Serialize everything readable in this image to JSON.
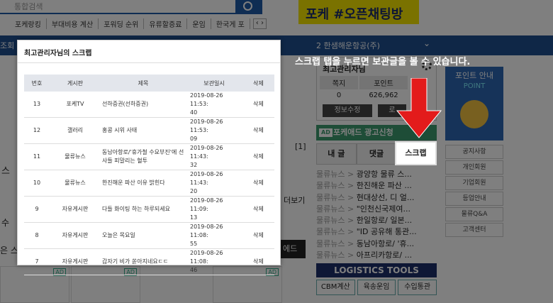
{
  "background": {
    "search_placeholder": "통합검색",
    "quick_links": [
      "포케랑킹",
      "부대비용 계산",
      "포워딩 순위",
      "유류할증료",
      "운임",
      "한국게 포"
    ],
    "ad_banner_text": "포케 #오픈채팅방",
    "nav_left": "조회",
    "nav_item": "2  한샘해운항공(주)",
    "login": {
      "user": "최고관리자님",
      "stats": [
        {
          "label": "쪽지",
          "value": "0"
        },
        {
          "label": "포인트",
          "value": "626,962"
        }
      ],
      "buttons": [
        "정보수정",
        "로"
      ]
    },
    "ad_strip": {
      "tag": "AD",
      "text": "포케애드 광고신청"
    },
    "tabs": [
      {
        "label": "내 글"
      },
      {
        "label": "댓글"
      },
      {
        "label": "스크랩"
      }
    ],
    "posts": [
      {
        "cat": "물류뉴스 >",
        "title": "광양항 물류 스..."
      },
      {
        "cat": "물류뉴스 >",
        "title": "한진해운 파산 ..."
      },
      {
        "cat": "물류뉴스 >",
        "title": "현대상선, 디 얼..."
      },
      {
        "cat": "물류뉴스 >",
        "title": "\"인천신국제여..."
      },
      {
        "cat": "물류뉴스 >",
        "title": "한일항로/ 일본..."
      },
      {
        "cat": "물류뉴스 >",
        "title": "\"ID 공유해 통관..."
      },
      {
        "cat": "물류뉴스 >",
        "title": "동남아항로/ '휴..."
      },
      {
        "cat": "물류뉴스 >",
        "title": "아프리카항로/ ..."
      }
    ],
    "logistics_tools": "LOGISTICS TOOLS",
    "tool_buttons": [
      "CBM계산",
      "육송운임",
      "수입통관"
    ],
    "side_poster": {
      "line1": "포인트 안내",
      "line2": "POINT"
    },
    "side_menu": [
      "공지사항",
      "개인회원",
      "기업회원",
      "등업안내",
      "물류Q&A",
      "고객센터"
    ],
    "fragments": {
      "page": "[1]",
      "more": "더보기",
      "ad_btn": "에드",
      "left_text": "스",
      "left_text2": "은 스",
      "side_mark": "수"
    }
  },
  "popup": {
    "title": "최고관리자님의 스크랩",
    "columns": [
      "번호",
      "게시판",
      "제목",
      "보관일시",
      "삭제"
    ],
    "rows": [
      {
        "no": "13",
        "board": "포케TV",
        "title": "선하증권(선하증권)",
        "date1": "2019-08-26 11:53:",
        "date2": "40",
        "del": "삭제"
      },
      {
        "no": "12",
        "board": "갤러리",
        "title": "홍콩 시위 사태",
        "date1": "2019-08-26 11:53:",
        "date2": "09",
        "del": "삭제"
      },
      {
        "no": "11",
        "board": "물류뉴스",
        "title": "동남아항로/'휴가철 수요부진'에 선사들 피말리는 혈투",
        "date1": "2019-08-26 11:43:",
        "date2": "32",
        "del": "삭제"
      },
      {
        "no": "10",
        "board": "물류뉴스",
        "title": "한진해운 파산 이유 밝힌다",
        "date1": "2019-08-26 11:43:",
        "date2": "20",
        "del": "삭제"
      },
      {
        "no": "9",
        "board": "자유게시판",
        "title": "다들 화이팅 하는 하루되세요",
        "date1": "2019-08-26 11:09:",
        "date2": "13",
        "del": "삭제"
      },
      {
        "no": "8",
        "board": "자유게시판",
        "title": "오늘은 목요일",
        "date1": "2019-08-26 11:08:",
        "date2": "55",
        "del": "삭제"
      },
      {
        "no": "7",
        "board": "자유게시판",
        "title": "갑자기 비가 쏟아지네요ㄷㄷ",
        "date1": "2019-08-26 11:08:",
        "date2": "46",
        "del": "삭제"
      }
    ]
  },
  "annotation": {
    "notice": "스크랩 탭을 누르면 보관글을 볼 수 있습니다.",
    "arrow_color": "#e31b1b"
  }
}
